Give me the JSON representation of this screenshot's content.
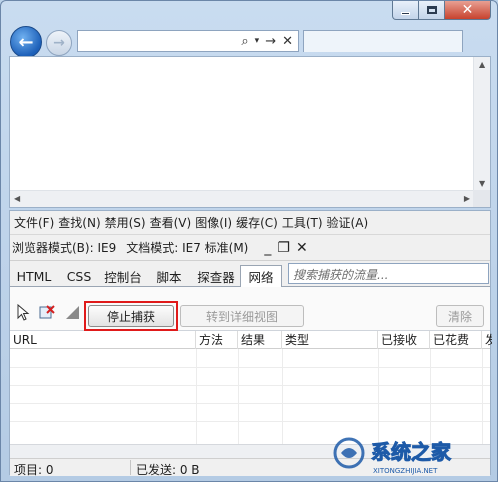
{
  "window": {
    "minimize_icon": "minimize-icon",
    "maximize_icon": "maximize-icon",
    "close_icon": "close-icon"
  },
  "nav": {
    "back_icon": "back-arrow-icon",
    "forward_icon": "forward-arrow-icon",
    "address_value": "",
    "search_glyph": "⌕",
    "go_glyph": "→",
    "stop_glyph": "✕"
  },
  "devtools": {
    "menu": [
      "文件(F)",
      "查找(N)",
      "禁用(S)",
      "查看(V)",
      "图像(I)",
      "缓存(C)",
      "工具(T)",
      "验证(A)"
    ],
    "browser_mode": "浏览器模式(B): IE9",
    "doc_mode": "文档模式: IE7 标准(M)",
    "tabs": [
      "HTML",
      "CSS",
      "控制台",
      "脚本",
      "探查器",
      "网络"
    ],
    "active_tab": "网络",
    "search_placeholder": "搜索捕获的流量...",
    "buttons": {
      "stop_capture": "停止捕获",
      "go_detail": "转到详细视图",
      "clear": "清除"
    },
    "columns": [
      "URL",
      "方法",
      "结果",
      "类型",
      "已接收",
      "已花费",
      "发"
    ],
    "status": {
      "items": "项目: 0",
      "sent": "已发送: 0 B"
    }
  },
  "watermark": {
    "text": "系统之家",
    "subtext": "XITONGZHIJIA.NET",
    "color": "#1d5aa8"
  }
}
